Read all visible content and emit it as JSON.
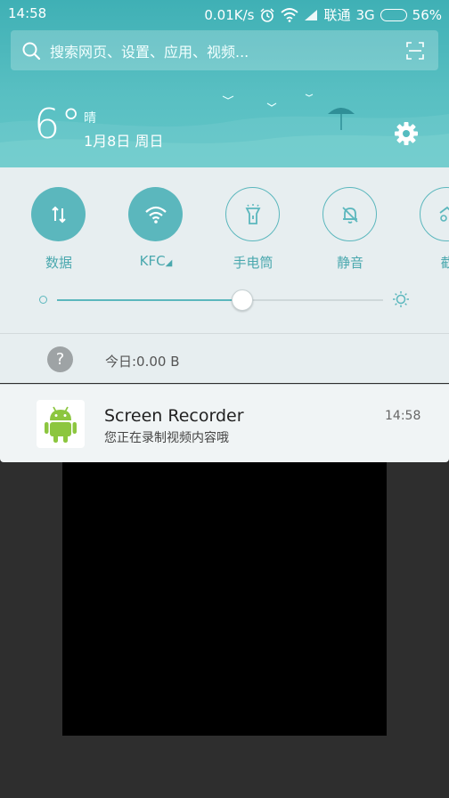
{
  "status_bar": {
    "time": "14:58",
    "speed": "0.01K/s",
    "carrier": "联通",
    "network": "3G",
    "battery": "56%"
  },
  "search": {
    "placeholder": "搜索网页、设置、应用、视频..."
  },
  "weather": {
    "temperature": "6°",
    "condition": "晴",
    "date": "1月8日 周日"
  },
  "quick_toggles": [
    {
      "label": "数据",
      "icon": "data-arrows-icon",
      "active": true
    },
    {
      "label": "KFC",
      "icon": "wifi-icon",
      "active": true
    },
    {
      "label": "手电筒",
      "icon": "flashlight-icon",
      "active": false
    },
    {
      "label": "静音",
      "icon": "bell-mute-icon",
      "active": false
    },
    {
      "label": "截",
      "icon": "screenshot-icon",
      "active": false
    }
  ],
  "brightness": {
    "level": 0.57
  },
  "data_usage": {
    "text": "今日:0.00 B",
    "icon": "question-icon"
  },
  "notification": {
    "app_icon": "android-icon",
    "title": "Screen Recorder",
    "text": "您正在录制视频内容哦",
    "time": "14:58"
  },
  "colors": {
    "accent": "#5bb7bd",
    "header": "#4fb8bc"
  }
}
